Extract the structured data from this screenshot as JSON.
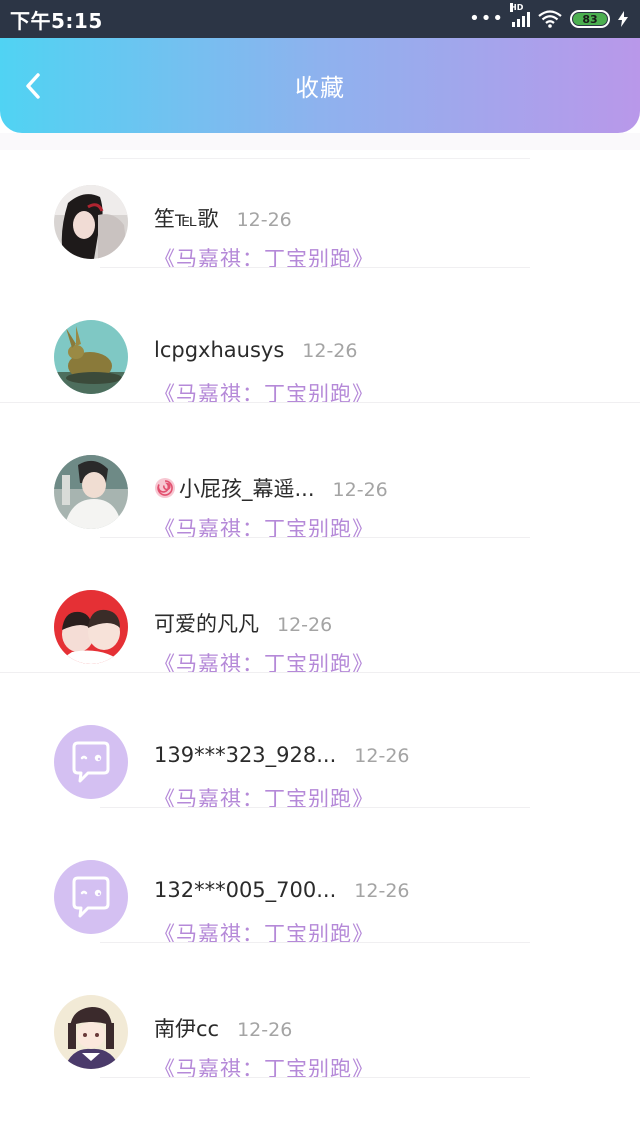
{
  "status_bar": {
    "time": "下午5:15",
    "network": "HD",
    "battery": "83"
  },
  "header": {
    "title": "收藏"
  },
  "items": [
    {
      "name": "笙℡歌",
      "date": "12-26",
      "title": "《马嘉祺：丁宝别跑》",
      "avatar": "photo-girl"
    },
    {
      "name": "lcpgxhausys",
      "date": "12-26",
      "title": "《马嘉祺：丁宝别跑》",
      "avatar": "photo-rabbit-statue"
    },
    {
      "name": "小屁孩_幕遥...",
      "date": "12-26",
      "title": "《马嘉祺：丁宝别跑》",
      "avatar": "photo-boy"
    },
    {
      "name": "可爱的凡凡",
      "date": "12-26",
      "title": "《马嘉祺：丁宝别跑》",
      "avatar": "photo-kids-red"
    },
    {
      "name": "139***323_928...",
      "date": "12-26",
      "title": "《马嘉祺：丁宝别跑》",
      "avatar": "default-chat-bubble"
    },
    {
      "name": "132***005_700...",
      "date": "12-26",
      "title": "《马嘉祺：丁宝别跑》",
      "avatar": "default-chat-bubble"
    },
    {
      "name": "南伊cc",
      "date": "12-26",
      "title": "《马嘉祺：丁宝别跑》",
      "avatar": "photo-anime-girl"
    }
  ],
  "colors": {
    "header_gradient": [
      "#50d3f3",
      "#8eb2ee",
      "#b998ea"
    ],
    "title_purple": "#b589d8",
    "default_avatar": "#d4c0f2"
  }
}
